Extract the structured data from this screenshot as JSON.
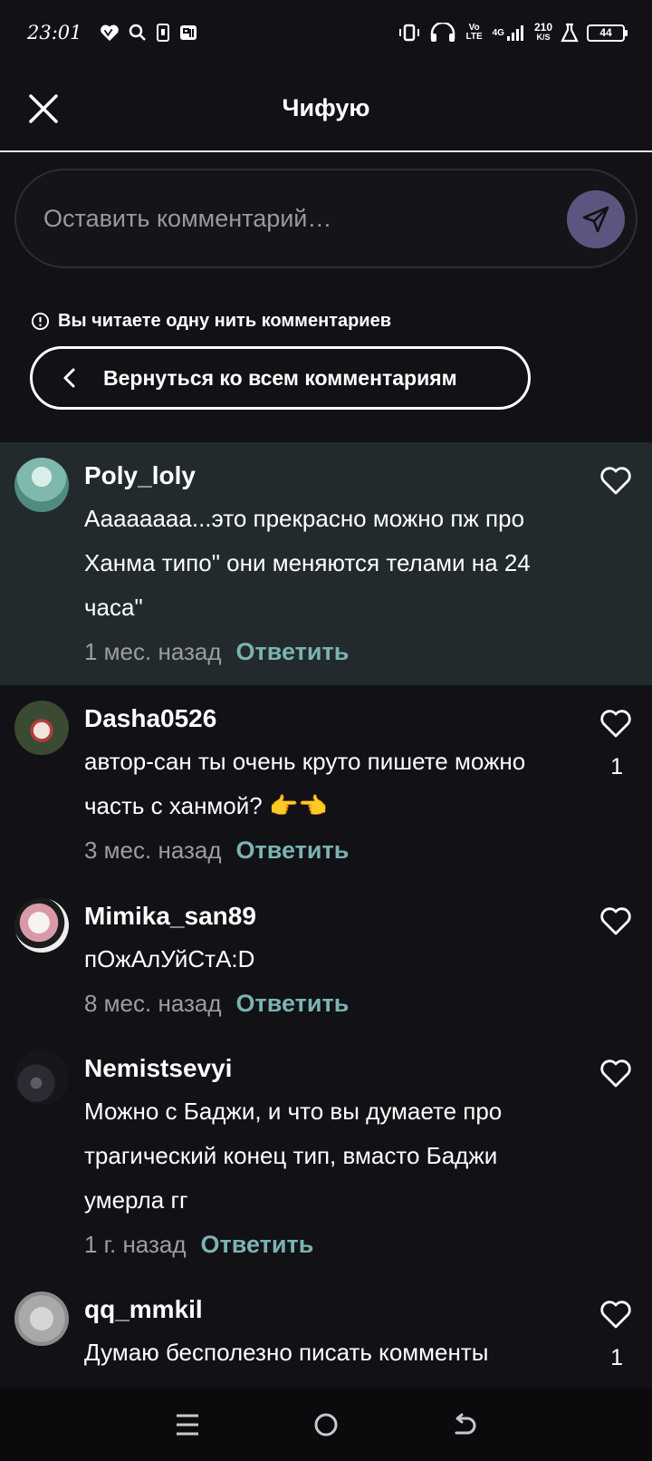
{
  "status_bar": {
    "time": "23:01",
    "network_speed": "210",
    "network_speed_unit": "K/S",
    "battery": "44",
    "volte": "Vo LTE",
    "net_type": "4G"
  },
  "header": {
    "title": "Чифую"
  },
  "comment_input": {
    "placeholder": "Оставить комментарий…"
  },
  "thread_notice": {
    "text": "Вы читаете одну нить комментариев",
    "back_label": "Вернуться ко всем комментариям"
  },
  "comments": [
    {
      "username": "Poly_loly",
      "text": "Аааааааа...это прекрасно можно пж про  Ханма типо\" они меняются телами на 24 часа\"",
      "time": "1 мес. назад",
      "reply": "Ответить",
      "likes": "",
      "highlighted": true,
      "avatar_color": "#6fa79b"
    },
    {
      "username": "Dasha0526",
      "text": "автор-сан ты очень круто пишете можно часть с ханмой? 👉👈",
      "time": "3 мес. назад",
      "reply": "Ответить",
      "likes": "1",
      "avatar_color": "#5a6b4f"
    },
    {
      "username": "Mimika_san89",
      "text": "пОжАлУйСтА:D",
      "time": "8 мес. назад",
      "reply": "Ответить",
      "likes": "",
      "avatar_color": "#e6c7cf"
    },
    {
      "username": "Nemistsevyi",
      "text": "Можно с Баджи, и что вы думаете про трагический конец тип, вмасто Баджи умерла гг",
      "time": "1 г. назад",
      "reply": "Ответить",
      "likes": "",
      "avatar_color": "#2a2a32"
    },
    {
      "username": "qq_mmkil",
      "text": "Думаю бесполезно писать комменты",
      "time": "",
      "reply": "",
      "likes": "1",
      "avatar_color": "#b5b5b5"
    }
  ]
}
